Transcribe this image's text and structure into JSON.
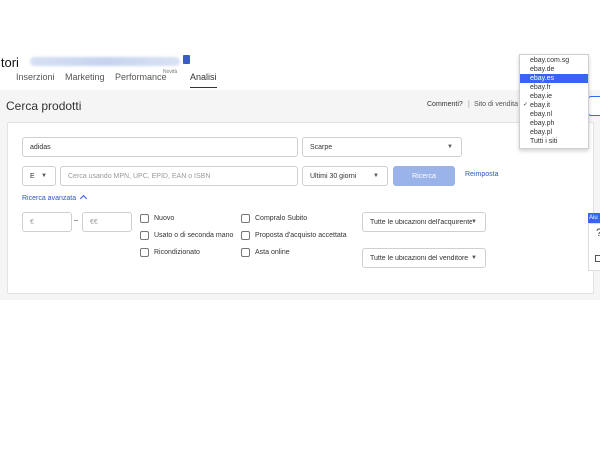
{
  "header": {
    "title": "itori",
    "account_icon": "badge-icon"
  },
  "nav": {
    "items": [
      {
        "label": "Inserzioni"
      },
      {
        "label": "Marketing"
      },
      {
        "label": "Performance",
        "badge": "Novità"
      },
      {
        "label": "Analisi",
        "active": true
      }
    ]
  },
  "page": {
    "title": "Cerca prodotti",
    "feedback_label": "Commenti?",
    "separator": "|",
    "site_label": "Sito di vendita"
  },
  "search": {
    "keyword_value": "adidas",
    "category_value": "Scarpe",
    "id_type_value": "E",
    "id_placeholder": "Cerca usando MPN, UPC, EPID, EAN o ISBN",
    "period_value": "Ultimi 30 giorni",
    "search_button": "Ricerca",
    "reset_link": "Reimposta",
    "advanced_link": "Ricerca avanzata",
    "price_min_placeholder": "€",
    "price_max_placeholder": "€€",
    "price_dash": "–"
  },
  "filters": {
    "condition": [
      "Nuovo",
      "Usato o di seconda mano",
      "Ricondizionato"
    ],
    "format": [
      "Compralo Subito",
      "Proposta d'acquisto accettata",
      "Asta online"
    ],
    "buyer_location": "Tutte le ubicazioni dell'acquirente",
    "seller_location": "Tutte le ubicazioni del venditore"
  },
  "site_dropdown": {
    "items": [
      {
        "label": "ebay.com.sg"
      },
      {
        "label": "ebay.de"
      },
      {
        "label": "ebay.es",
        "highlighted": true
      },
      {
        "label": "ebay.fr"
      },
      {
        "label": "ebay.ie"
      },
      {
        "label": "ebay.it",
        "selected": true
      },
      {
        "label": "ebay.nl"
      },
      {
        "label": "ebay.ph"
      },
      {
        "label": "ebay.pl"
      },
      {
        "label": "Tutti i siti"
      }
    ],
    "check_glyph": "✓"
  },
  "help": {
    "tab_label": "Aiu",
    "glyph": "?"
  },
  "colors": {
    "accent": "#3665f3",
    "button_disabled": "#9ab3e8",
    "link": "#2a55c8"
  }
}
